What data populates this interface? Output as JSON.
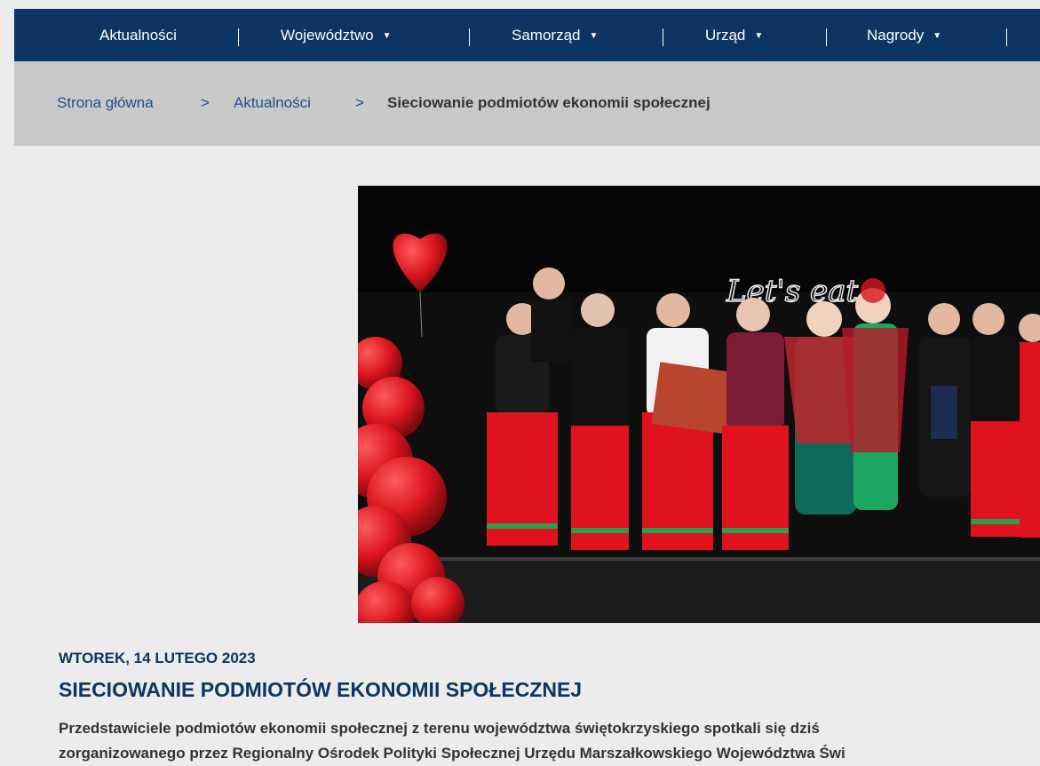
{
  "nav": {
    "items": [
      {
        "label": "Aktualności",
        "has_dropdown": false
      },
      {
        "label": "Województwo",
        "has_dropdown": true
      },
      {
        "label": "Samorząd",
        "has_dropdown": true
      },
      {
        "label": "Urząd",
        "has_dropdown": true
      },
      {
        "label": "Nagrody",
        "has_dropdown": true
      }
    ],
    "caret": "▼",
    "background": "#0d3463"
  },
  "breadcrumb": {
    "home": "Strona główna",
    "separator": ">",
    "section": "Aktualności",
    "current": "Sieciowanie podmiotów ekonomii społecznej"
  },
  "article": {
    "date": "WTOREK, 14 LUTEGO 2023",
    "title": "SIECIOWANIE PODMIOTÓW EKONOMII SPOŁECZNEJ",
    "lead_line1": "Przedstawiciele podmiotów ekonomii społecznej z terenu województwa świętokrzyskiego spotkali się dziś",
    "lead_line2": "zorganizowanego przez Regionalny Ośrodek Polityki Społecznej Urzędu Marszałkowskiego Województwa Świ",
    "image_icon": "group-photo-image"
  },
  "colors": {
    "accent": "#0d3463",
    "link": "#1f4e8c",
    "breadcrumb_bg": "#c9c9c9",
    "page_bg": "#ececec"
  }
}
